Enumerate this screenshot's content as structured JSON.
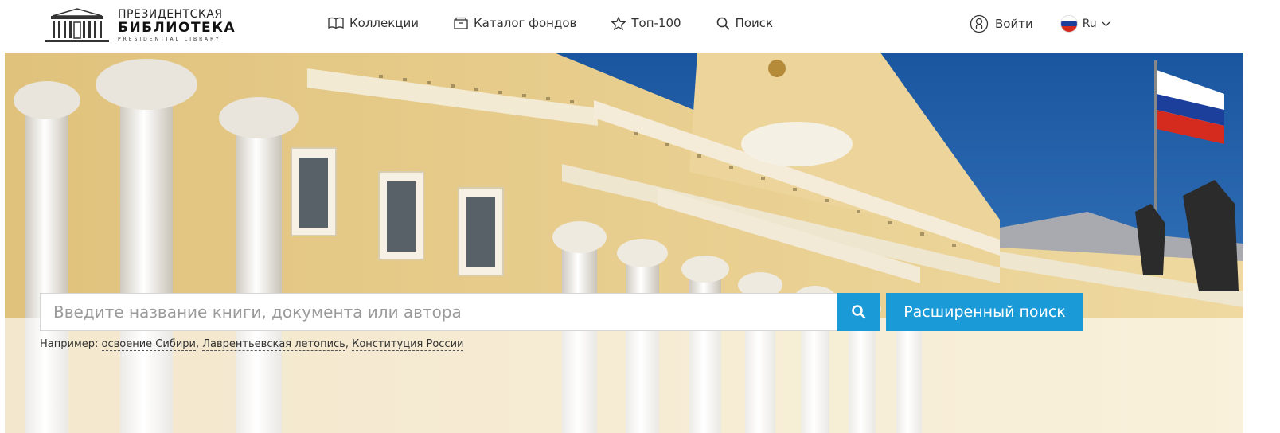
{
  "logo": {
    "line1": "ПРЕЗИДЕНТСКАЯ",
    "line2": "БИБЛИОТЕКА",
    "line3": "PRESIDENTIAL   LIBRARY",
    "icon": "building-logo-icon"
  },
  "nav": {
    "items": [
      {
        "label": "Коллекции",
        "icon": "book-icon"
      },
      {
        "label": "Каталог фондов",
        "icon": "catalog-icon"
      },
      {
        "label": "Топ-100",
        "icon": "star-icon"
      },
      {
        "label": "Поиск",
        "icon": "search-icon"
      }
    ]
  },
  "user": {
    "login_label": "Войти",
    "login_icon": "user-icon",
    "lang_label": "Ru",
    "lang_icon": "chevron-down-icon"
  },
  "search": {
    "placeholder": "Введите название книги, документа или автора",
    "value": "",
    "button_icon": "search-icon",
    "advanced_label": "Расширенный поиск",
    "examples_prefix": "Например: ",
    "examples": [
      "освоение Сибири",
      "Лаврентьевская летопись",
      "Конституция России"
    ],
    "separator": ", "
  },
  "colors": {
    "accent": "#1a9ad6",
    "facade": "#e9d39a",
    "sky": "#1f5fa8"
  }
}
